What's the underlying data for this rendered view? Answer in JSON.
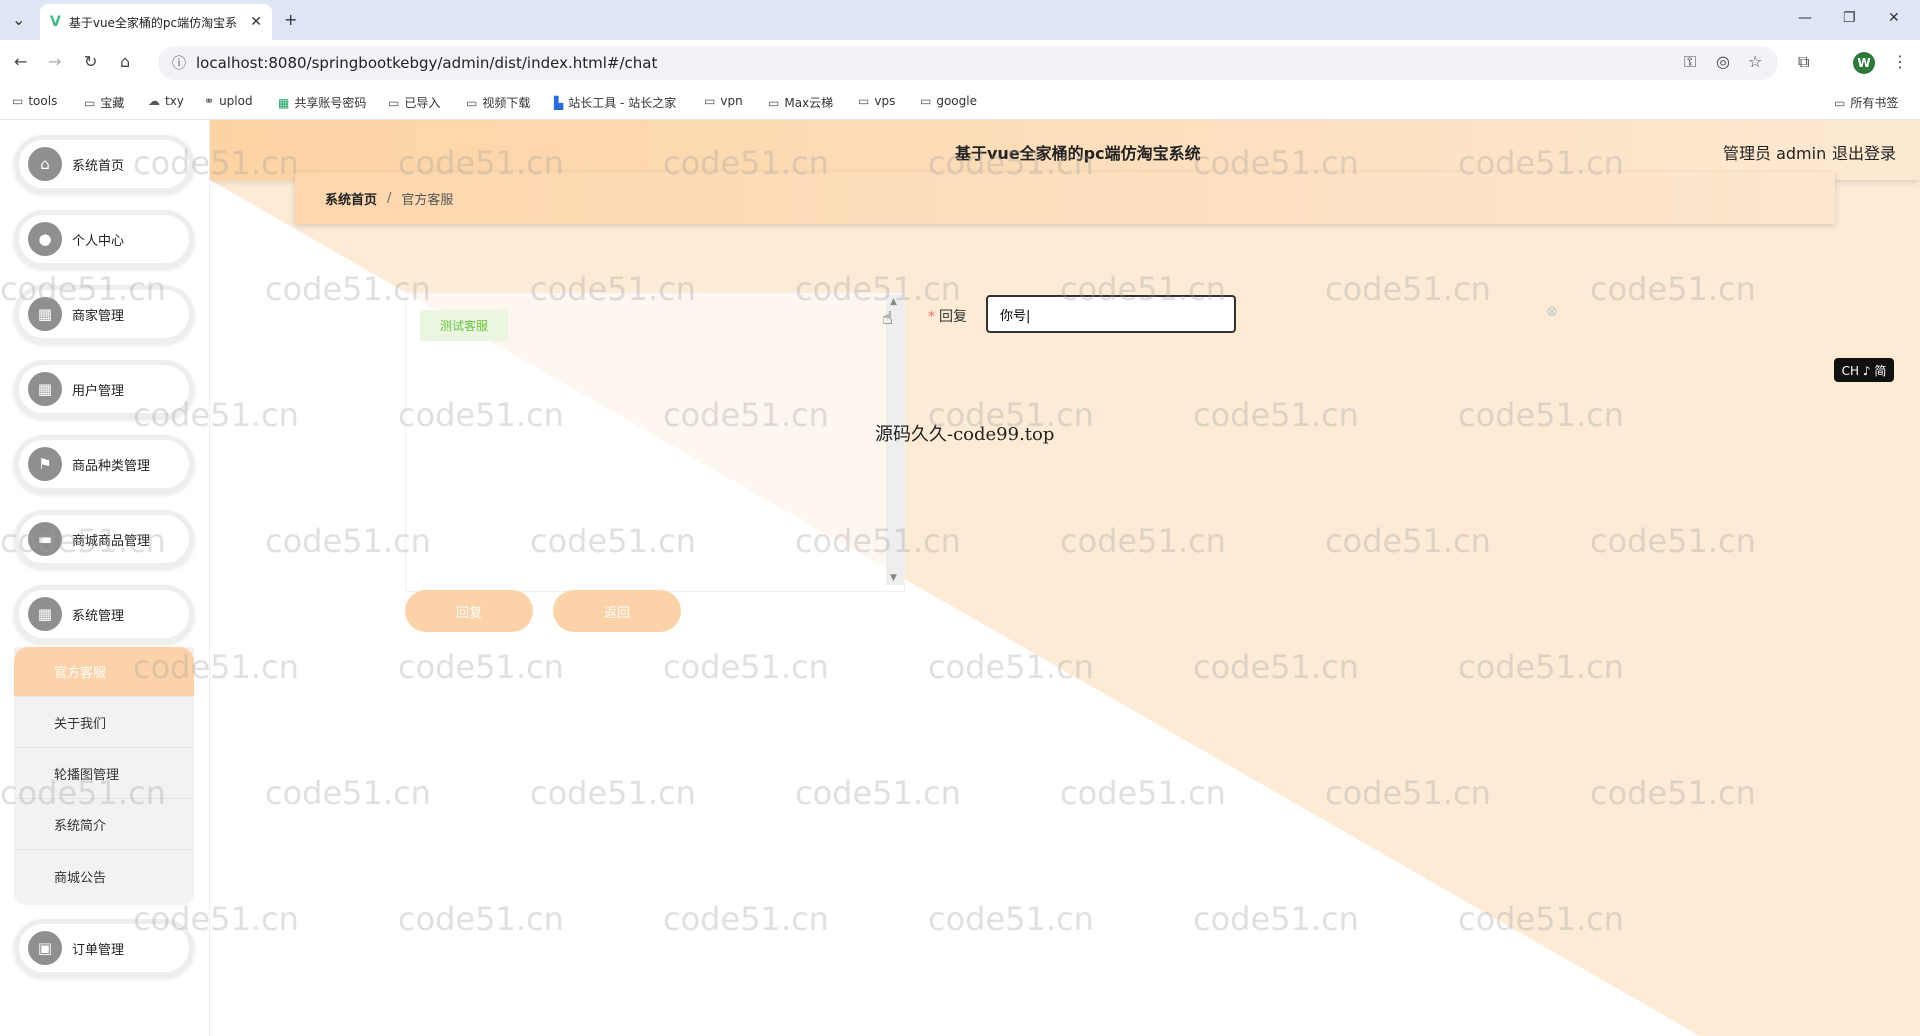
{
  "browser": {
    "tab_title": "基于vue全家桶的pc端仿淘宝系",
    "url": "localhost:8080/springbootkebgy/admin/dist/index.html#/chat",
    "profile_initial": "W",
    "bookmarks": [
      "tools",
      "宝藏",
      "txy",
      "uplod",
      "共享账号密码",
      "已导入",
      "视频下载",
      "站长工具 - 站长之家",
      "vpn",
      "Max云梯",
      "vps",
      "google"
    ],
    "all_bookmarks": "所有书签"
  },
  "header": {
    "title": "基于vue全家桶的pc端仿淘宝系统",
    "admin": "管理员 admin",
    "logout": "退出登录"
  },
  "breadcrumb": {
    "home": "系统首页",
    "separator": "/",
    "current": "官方客服"
  },
  "sidebar": {
    "items": [
      {
        "label": "系统首页",
        "icon": "home-icon"
      },
      {
        "label": "个人中心",
        "icon": "user-icon"
      },
      {
        "label": "商家管理",
        "icon": "grid-icon"
      },
      {
        "label": "用户管理",
        "icon": "grid-icon"
      },
      {
        "label": "商品种类管理",
        "icon": "flag-icon"
      },
      {
        "label": "商城商品管理",
        "icon": "monitor-icon"
      },
      {
        "label": "系统管理",
        "icon": "grid-icon"
      }
    ],
    "submenu": [
      "官方客服",
      "关于我们",
      "轮播图管理",
      "系统简介",
      "商城公告"
    ],
    "last_item": {
      "label": "订单管理",
      "icon": "bag-icon"
    }
  },
  "chat": {
    "message": "测试客服",
    "reply_label": "回复",
    "reply_value": "你号|",
    "reply_button": "回复",
    "back_button": "返回"
  },
  "overlay": {
    "center_watermark": "源码久久-code99.top",
    "ime": "CH ♪ 简",
    "watermark_text": "code51.cn"
  },
  "colors": {
    "accent": "#fcd3a8",
    "header_start": "#fdd3a3",
    "header_end": "#fde9d2",
    "message_bg": "#eaf5e2",
    "message_text": "#67c23a"
  }
}
